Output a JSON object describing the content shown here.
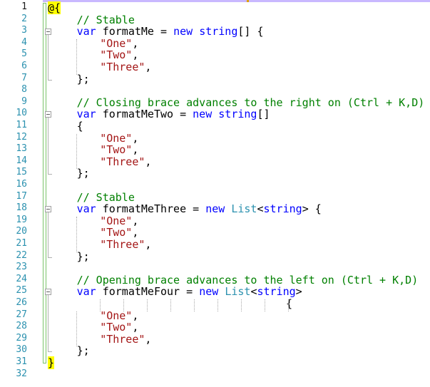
{
  "editor": {
    "line_numbers": [
      "1",
      "2",
      "3",
      "4",
      "5",
      "6",
      "7",
      "8",
      "9",
      "10",
      "11",
      "12",
      "13",
      "14",
      "15",
      "16",
      "17",
      "18",
      "19",
      "20",
      "21",
      "22",
      "23",
      "24",
      "25",
      "26",
      "27",
      "28",
      "29",
      "30",
      "31",
      "32"
    ],
    "lines": [
      {
        "indent": 0,
        "segs": [
          {
            "t": "@{",
            "c": "razor"
          }
        ]
      },
      {
        "indent": 4,
        "segs": [
          {
            "t": "// Stable",
            "c": "cm"
          }
        ]
      },
      {
        "indent": 4,
        "segs": [
          {
            "t": "var",
            "c": "kw"
          },
          {
            "t": " formatMe = ",
            "c": "pl"
          },
          {
            "t": "new",
            "c": "kw"
          },
          {
            "t": " ",
            "c": "pl"
          },
          {
            "t": "string",
            "c": "kw"
          },
          {
            "t": "[] {",
            "c": "pl"
          }
        ]
      },
      {
        "indent": 8,
        "segs": [
          {
            "t": "\"One\"",
            "c": "str"
          },
          {
            "t": ",",
            "c": "pl"
          }
        ]
      },
      {
        "indent": 8,
        "segs": [
          {
            "t": "\"Two\"",
            "c": "str"
          },
          {
            "t": ",",
            "c": "pl"
          }
        ]
      },
      {
        "indent": 8,
        "segs": [
          {
            "t": "\"Three\"",
            "c": "str"
          },
          {
            "t": ",",
            "c": "pl"
          }
        ]
      },
      {
        "indent": 4,
        "segs": [
          {
            "t": "};",
            "c": "pl"
          }
        ]
      },
      {
        "indent": 0,
        "segs": []
      },
      {
        "indent": 4,
        "segs": [
          {
            "t": "// Closing brace advances to the right on (Ctrl + K,D)",
            "c": "cm"
          }
        ]
      },
      {
        "indent": 4,
        "segs": [
          {
            "t": "var",
            "c": "kw"
          },
          {
            "t": " formatMeTwo = ",
            "c": "pl"
          },
          {
            "t": "new",
            "c": "kw"
          },
          {
            "t": " ",
            "c": "pl"
          },
          {
            "t": "string",
            "c": "kw"
          },
          {
            "t": "[]",
            "c": "pl"
          }
        ]
      },
      {
        "indent": 4,
        "segs": [
          {
            "t": "{",
            "c": "pl"
          }
        ]
      },
      {
        "indent": 8,
        "segs": [
          {
            "t": "\"One\"",
            "c": "str"
          },
          {
            "t": ",",
            "c": "pl"
          }
        ]
      },
      {
        "indent": 8,
        "segs": [
          {
            "t": "\"Two\"",
            "c": "str"
          },
          {
            "t": ",",
            "c": "pl"
          }
        ]
      },
      {
        "indent": 8,
        "segs": [
          {
            "t": "\"Three\"",
            "c": "str"
          },
          {
            "t": ",",
            "c": "pl"
          }
        ]
      },
      {
        "indent": 4,
        "segs": [
          {
            "t": "};",
            "c": "pl"
          }
        ]
      },
      {
        "indent": 0,
        "segs": []
      },
      {
        "indent": 4,
        "segs": [
          {
            "t": "// Stable",
            "c": "cm"
          }
        ]
      },
      {
        "indent": 4,
        "segs": [
          {
            "t": "var",
            "c": "kw"
          },
          {
            "t": " formatMeThree = ",
            "c": "pl"
          },
          {
            "t": "new",
            "c": "kw"
          },
          {
            "t": " ",
            "c": "pl"
          },
          {
            "t": "List",
            "c": "ty"
          },
          {
            "t": "<",
            "c": "pl"
          },
          {
            "t": "string",
            "c": "kw"
          },
          {
            "t": "> {",
            "c": "pl"
          }
        ]
      },
      {
        "indent": 8,
        "segs": [
          {
            "t": "\"One\"",
            "c": "str"
          },
          {
            "t": ",",
            "c": "pl"
          }
        ]
      },
      {
        "indent": 8,
        "segs": [
          {
            "t": "\"Two\"",
            "c": "str"
          },
          {
            "t": ",",
            "c": "pl"
          }
        ]
      },
      {
        "indent": 8,
        "segs": [
          {
            "t": "\"Three\"",
            "c": "str"
          },
          {
            "t": ",",
            "c": "pl"
          }
        ]
      },
      {
        "indent": 4,
        "segs": [
          {
            "t": "};",
            "c": "pl"
          }
        ]
      },
      {
        "indent": 0,
        "segs": []
      },
      {
        "indent": 4,
        "segs": [
          {
            "t": "// Opening brace advances to the left on (Ctrl + K,D)",
            "c": "cm"
          }
        ]
      },
      {
        "indent": 4,
        "segs": [
          {
            "t": "var",
            "c": "kw"
          },
          {
            "t": " formatMeFour = ",
            "c": "pl"
          },
          {
            "t": "new",
            "c": "kw"
          },
          {
            "t": " ",
            "c": "pl"
          },
          {
            "t": "List",
            "c": "ty"
          },
          {
            "t": "<",
            "c": "pl"
          },
          {
            "t": "string",
            "c": "kw"
          },
          {
            "t": ">",
            "c": "pl"
          }
        ]
      },
      {
        "indent": 40,
        "segs": [
          {
            "t": "{",
            "c": "pl"
          }
        ]
      },
      {
        "indent": 8,
        "segs": [
          {
            "t": "\"One\"",
            "c": "str"
          },
          {
            "t": ",",
            "c": "pl"
          }
        ]
      },
      {
        "indent": 8,
        "segs": [
          {
            "t": "\"Two\"",
            "c": "str"
          },
          {
            "t": ",",
            "c": "pl"
          }
        ]
      },
      {
        "indent": 8,
        "segs": [
          {
            "t": "\"Three\"",
            "c": "str"
          },
          {
            "t": ",",
            "c": "pl"
          }
        ]
      },
      {
        "indent": 4,
        "segs": [
          {
            "t": "};",
            "c": "pl"
          }
        ]
      },
      {
        "indent": 0,
        "segs": [
          {
            "t": "}",
            "c": "razor"
          }
        ]
      },
      {
        "indent": 0,
        "segs": []
      }
    ]
  },
  "colors": {
    "keyword": "#0000ff",
    "type": "#2b91af",
    "string": "#a31515",
    "comment": "#008000",
    "line_number": "#2b91af",
    "razor_highlight": "#ffff00",
    "change_margin": "#7ac36a"
  },
  "icons": [
    "collapse-icon"
  ]
}
